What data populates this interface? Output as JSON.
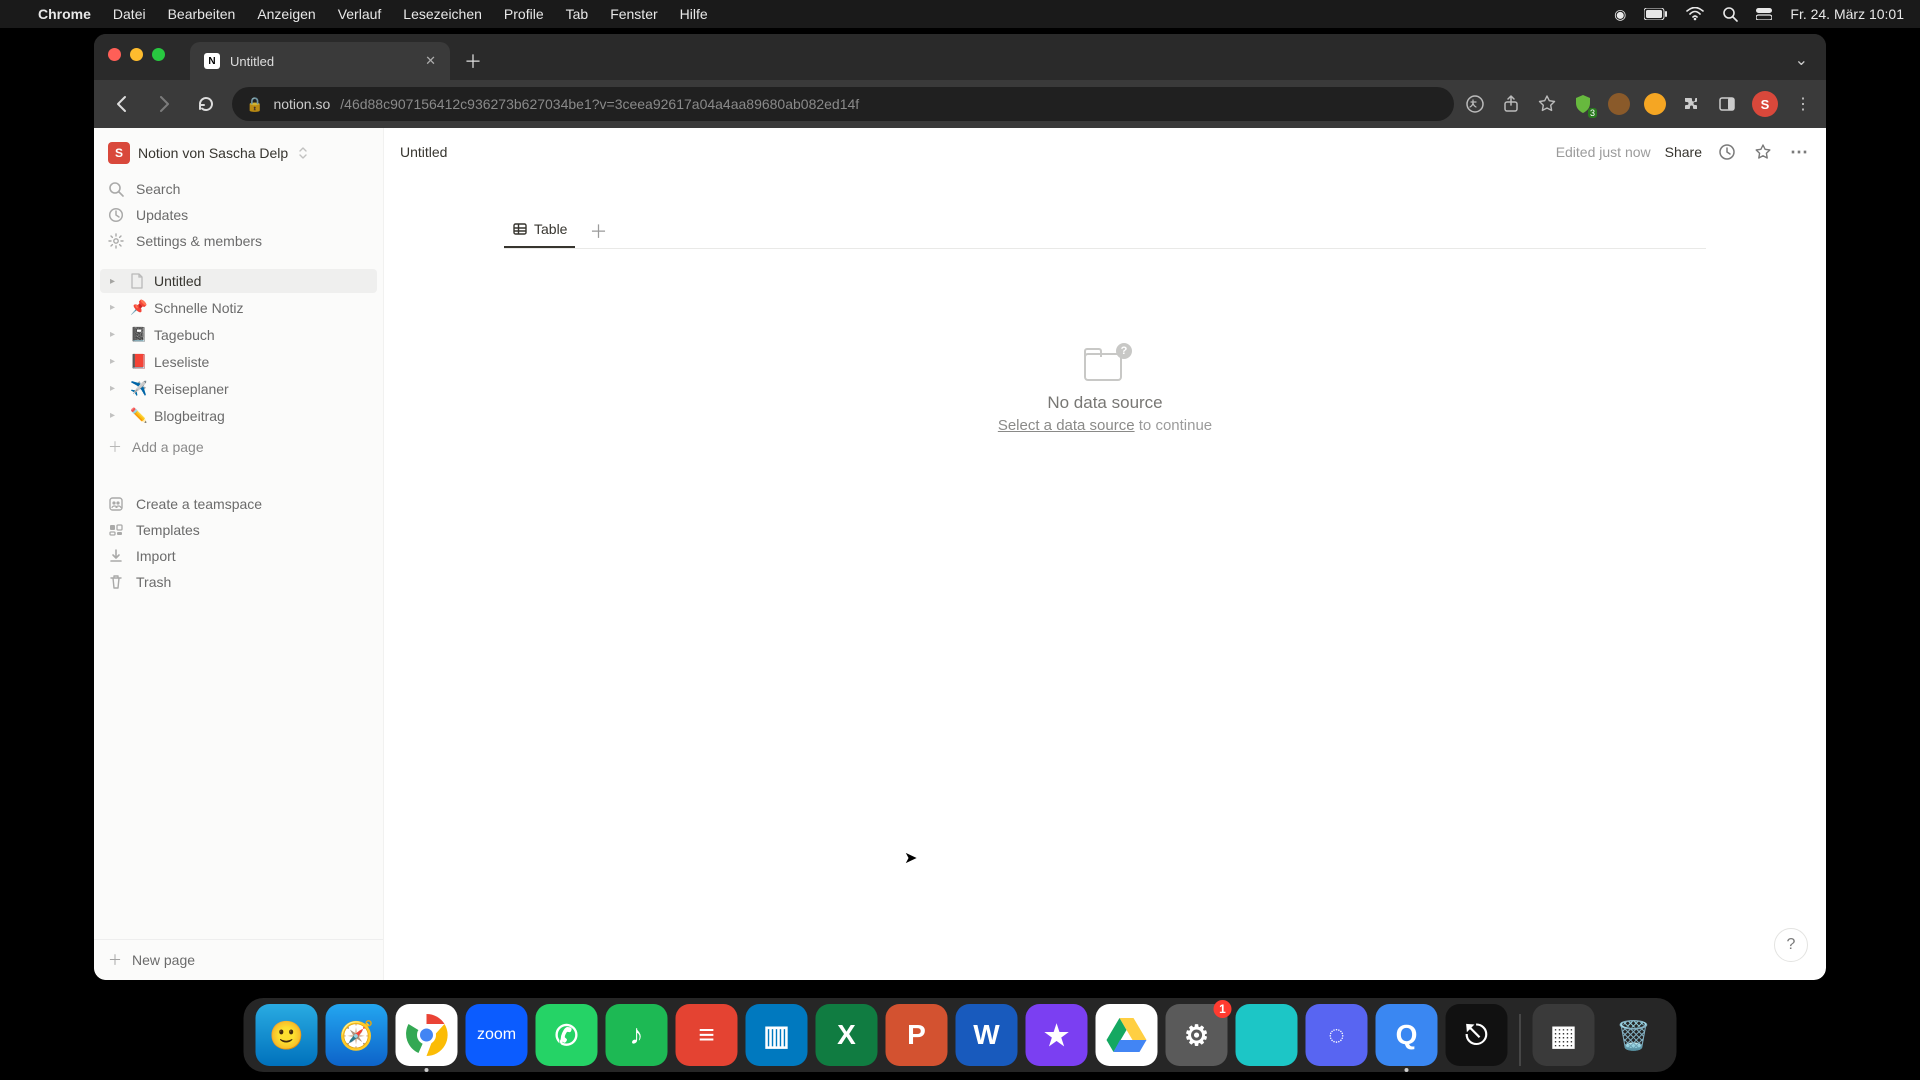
{
  "menubar": {
    "app": "Chrome",
    "items": [
      "Datei",
      "Bearbeiten",
      "Anzeigen",
      "Verlauf",
      "Lesezeichen",
      "Profile",
      "Tab",
      "Fenster",
      "Hilfe"
    ],
    "clock": "Fr. 24. März  10:01"
  },
  "chrome": {
    "tab_title": "Untitled",
    "url_host": "notion.so",
    "url_path": "/46d88c907156412c936273b627034be1?v=3ceea92617a04a4aa89680ab082ed14f",
    "avatar_initial": "S",
    "ext_badge": "3"
  },
  "notion": {
    "workspace": {
      "initial": "S",
      "name": "Notion von Sascha Delp"
    },
    "sidebar_top": [
      {
        "icon": "search",
        "label": "Search"
      },
      {
        "icon": "clock",
        "label": "Updates"
      },
      {
        "icon": "gear",
        "label": "Settings & members"
      }
    ],
    "pages": [
      {
        "emoji": "",
        "doc": true,
        "label": "Untitled",
        "active": true
      },
      {
        "emoji": "📌",
        "label": "Schnelle Notiz"
      },
      {
        "emoji": "📓",
        "label": "Tagebuch"
      },
      {
        "emoji": "📕",
        "label": "Leseliste"
      },
      {
        "emoji": "✈️",
        "label": "Reiseplaner"
      },
      {
        "emoji": "✏️",
        "label": "Blogbeitrag"
      }
    ],
    "add_page": "Add a page",
    "sidebar_bottom": [
      {
        "icon": "teamspace",
        "label": "Create a teamspace"
      },
      {
        "icon": "templates",
        "label": "Templates"
      },
      {
        "icon": "import",
        "label": "Import"
      },
      {
        "icon": "trash",
        "label": "Trash"
      }
    ],
    "new_page": "New page",
    "breadcrumb": "Untitled",
    "topbar": {
      "edited": "Edited just now",
      "share": "Share"
    },
    "view_tab": "Table",
    "empty": {
      "title": "No data source",
      "link": "Select a data source",
      "suffix": " to continue"
    },
    "help": "?"
  },
  "dock": {
    "apps": [
      {
        "name": "finder",
        "bg": "linear-gradient(#29abe2,#0071bc)",
        "glyph": "🙂"
      },
      {
        "name": "safari",
        "bg": "linear-gradient(#23a6f0,#0d63c9)",
        "glyph": "🧭"
      },
      {
        "name": "chrome",
        "bg": "#fff",
        "glyph": "◉",
        "running": true
      },
      {
        "name": "zoom",
        "bg": "#0b5cff",
        "glyph": "zoom",
        "text": true
      },
      {
        "name": "whatsapp",
        "bg": "#25d366",
        "glyph": "✆"
      },
      {
        "name": "spotify",
        "bg": "#1db954",
        "glyph": "♪"
      },
      {
        "name": "todoist",
        "bg": "#e44332",
        "glyph": "≡"
      },
      {
        "name": "trello",
        "bg": "#0079bf",
        "glyph": "▥"
      },
      {
        "name": "excel",
        "bg": "#107c41",
        "glyph": "X"
      },
      {
        "name": "powerpoint",
        "bg": "#d35230",
        "glyph": "P"
      },
      {
        "name": "word",
        "bg": "#185abd",
        "glyph": "W"
      },
      {
        "name": "imovie",
        "bg": "#7b3ff2",
        "glyph": "★"
      },
      {
        "name": "drive",
        "bg": "#fff",
        "glyph": "▲"
      },
      {
        "name": "settings",
        "bg": "#5a5a5a",
        "glyph": "⚙",
        "badge": "1"
      },
      {
        "name": "app-teal",
        "bg": "#1cc6c6",
        "glyph": ""
      },
      {
        "name": "discord",
        "bg": "#5865f2",
        "glyph": "◌"
      },
      {
        "name": "quicktime",
        "bg": "#3a87f2",
        "glyph": "Q",
        "running": true
      },
      {
        "name": "voice-memos",
        "bg": "#111",
        "glyph": "⎋"
      }
    ],
    "right": [
      {
        "name": "mission-control",
        "bg": "#3a3a3a",
        "glyph": "▦"
      },
      {
        "name": "trash",
        "bg": "transparent",
        "glyph": "🗑️"
      }
    ]
  }
}
